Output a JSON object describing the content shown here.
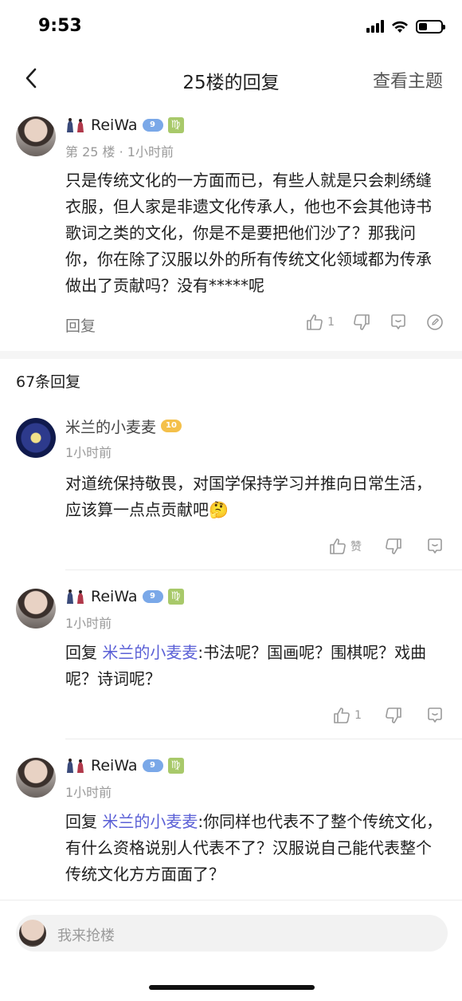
{
  "status": {
    "time": "9:53",
    "battery_level": 0.4
  },
  "nav": {
    "title": "25楼的回复",
    "action": "查看主题"
  },
  "main_post": {
    "username": "ReiWa",
    "level": "9",
    "floor_meta": "第 25 楼 · 1小时前",
    "content": "只是传统文化的一方面而已，有些人就是只会刺绣缝衣服，但人家是非遗文化传承人，他也不会其他诗书歌词之类的文化，你是不是要把他们沙了？那我问你，你在除了汉服以外的所有传统文化领域都为传承做出了贡献吗？没有*****呢",
    "reply_label": "回复",
    "like_count": "1"
  },
  "replies_header": "67条回复",
  "replies": [
    {
      "username": "米兰的小麦麦",
      "level": "10",
      "time": "1小时前",
      "content": "对道统保持敬畏，对国学保持学习并推向日常生活，应该算一点点贡献吧🤔",
      "like_label": "赞"
    },
    {
      "username": "ReiWa",
      "level": "9",
      "time": "1小时前",
      "reply_prefix": "回复 ",
      "mention": "米兰的小麦麦",
      "content": ":书法呢？国画呢？围棋呢？戏曲呢？诗词呢？",
      "like_label": "1"
    },
    {
      "username": "ReiWa",
      "level": "9",
      "time": "1小时前",
      "reply_prefix": "回复 ",
      "mention": "米兰的小麦麦",
      "content": ":你同样也代表不了整个传统文化，有什么资格说别人代表不了？汉服说自己能代表整个传统文化方方面面了？"
    }
  ],
  "composer": {
    "placeholder": "我来抢楼"
  },
  "icons": {
    "back": "chevron-left-icon",
    "like": "thumbs-up-icon",
    "dislike": "thumbs-down-icon",
    "comment": "comment-icon",
    "edit": "edit-icon"
  }
}
